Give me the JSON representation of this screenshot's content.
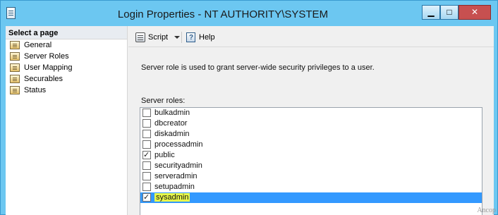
{
  "window": {
    "title": "Login Properties - NT AUTHORITY\\SYSTEM",
    "controls": {
      "minimize": "▁",
      "maximize": "□",
      "close": "✕"
    }
  },
  "sidebar": {
    "heading": "Select a page",
    "items": [
      {
        "label": "General",
        "icon": "page-icon"
      },
      {
        "label": "Server Roles",
        "icon": "page-icon"
      },
      {
        "label": "User Mapping",
        "icon": "page-icon"
      },
      {
        "label": "Securables",
        "icon": "page-icon"
      },
      {
        "label": "Status",
        "icon": "page-icon"
      }
    ]
  },
  "toolbar": {
    "script_label": "Script",
    "help_label": "Help"
  },
  "main": {
    "description": "Server role is used to grant server-wide security privileges to a user.",
    "roles_label": "Server roles:",
    "roles": [
      {
        "name": "bulkadmin",
        "checked": false
      },
      {
        "name": "dbcreator",
        "checked": false
      },
      {
        "name": "diskadmin",
        "checked": false
      },
      {
        "name": "processadmin",
        "checked": false
      },
      {
        "name": "public",
        "checked": true
      },
      {
        "name": "securityadmin",
        "checked": false
      },
      {
        "name": "serveradmin",
        "checked": false
      },
      {
        "name": "setupadmin",
        "checked": false
      },
      {
        "name": "sysadmin",
        "checked": true,
        "selected": true
      }
    ]
  },
  "colors": {
    "title_bar": "#6cc7f1",
    "selection": "#3399ff",
    "highlight": "#e8f84a",
    "close_button": "#c75050"
  },
  "watermark": "Ancop"
}
